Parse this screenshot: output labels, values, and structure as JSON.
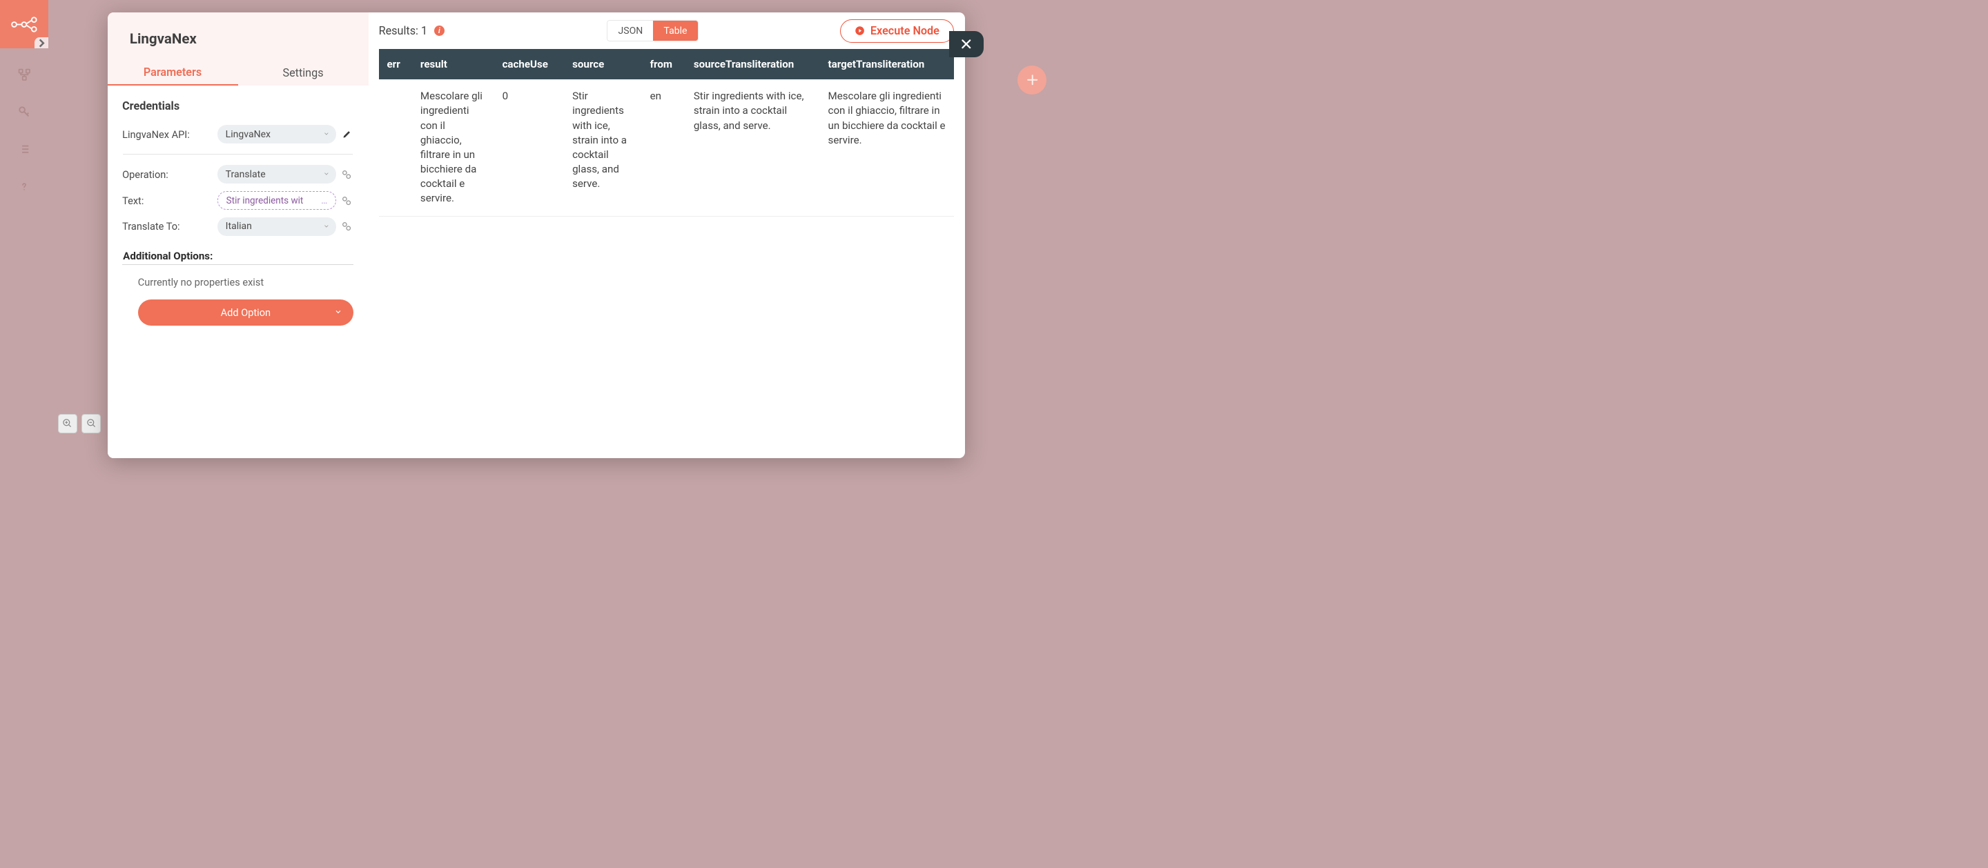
{
  "sidebar": {
    "items": [
      "workflows",
      "credentials",
      "executions",
      "help"
    ]
  },
  "modal": {
    "title": "LingvaNex",
    "tabs": {
      "parameters": "Parameters",
      "settings": "Settings"
    },
    "credentials_heading": "Credentials",
    "api_label": "LingvaNex API:",
    "api_value": "LingvaNex",
    "fields": {
      "operation_label": "Operation:",
      "operation_value": "Translate",
      "text_label": "Text:",
      "text_value": "Stir ingredients wit",
      "text_ellipsis": "…",
      "translate_to_label": "Translate To:",
      "translate_to_value": "Italian"
    },
    "additional_options_heading": "Additional Options:",
    "no_props_text": "Currently no properties exist",
    "add_option_label": "Add Option"
  },
  "results": {
    "label": "Results: 1",
    "format": {
      "json": "JSON",
      "table": "Table"
    },
    "execute_label": "Execute Node",
    "columns": [
      "err",
      "result",
      "cacheUse",
      "source",
      "from",
      "sourceTransliteration",
      "targetTransliteration"
    ],
    "rows": [
      {
        "err": "",
        "result": "Mescolare gli ingredienti con il ghiaccio, filtrare in un bicchiere da cocktail e servire.",
        "cacheUse": "0",
        "source": "Stir ingredients with ice, strain into a cocktail glass, and serve.",
        "from": "en",
        "sourceTransliteration": "Stir ingredients with ice, strain into a cocktail glass, and serve.",
        "targetTransliteration": "Mescolare gli ingredienti con il ghiaccio, filtrare in un bicchiere da cocktail e servire."
      }
    ]
  }
}
